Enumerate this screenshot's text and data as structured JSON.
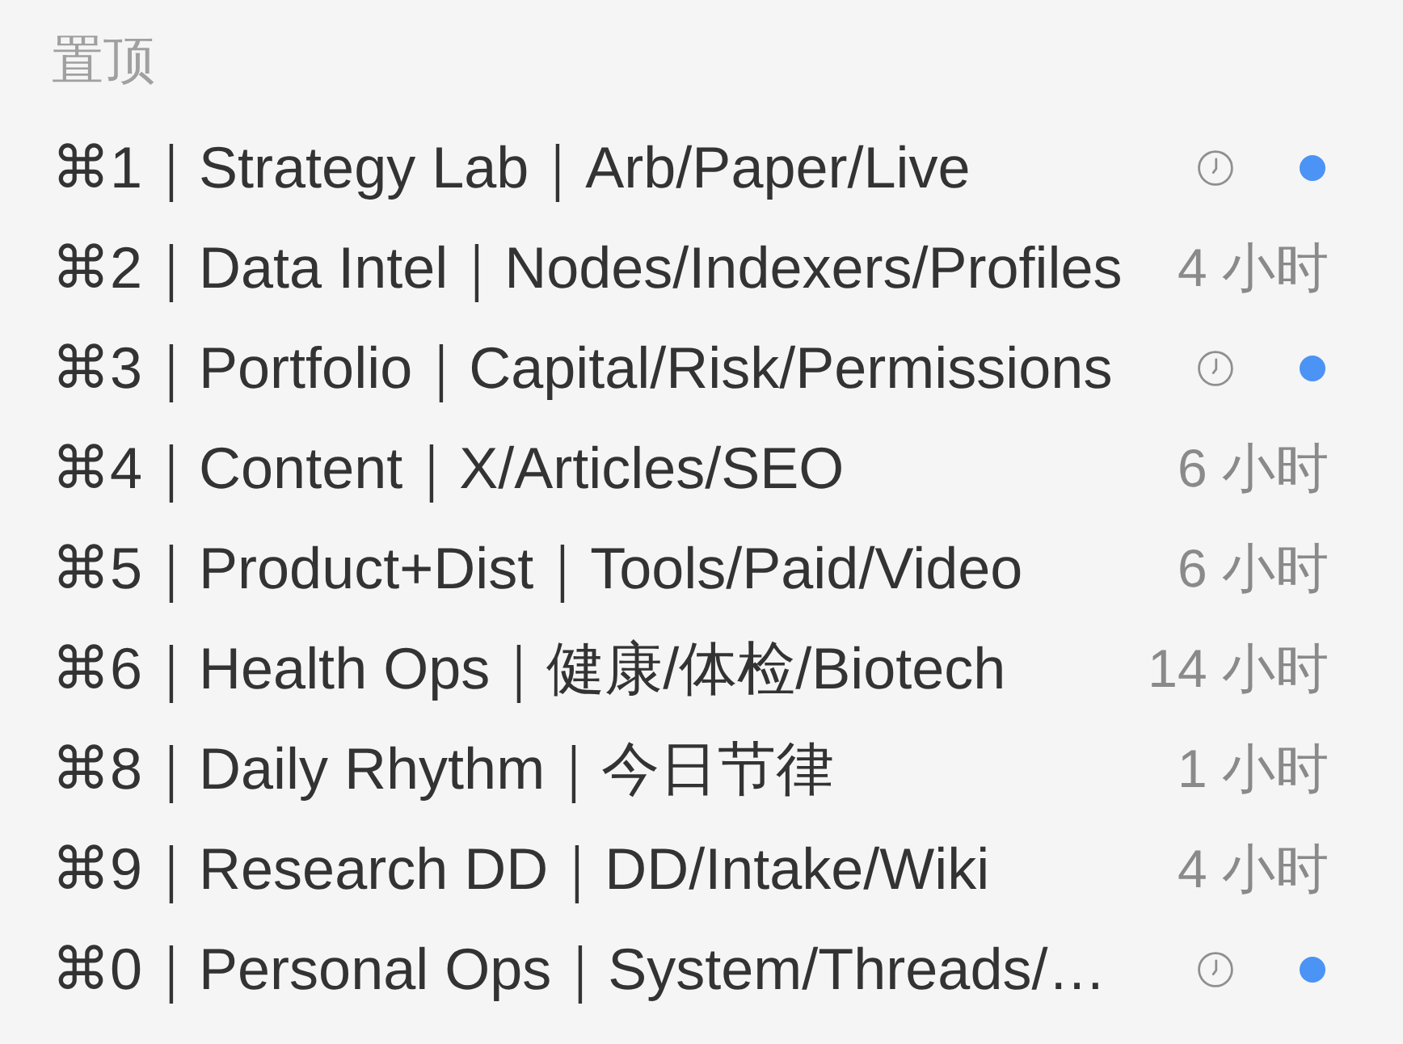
{
  "section": {
    "title": "置顶"
  },
  "items": [
    {
      "label": "⌘1｜Strategy Lab｜Arb/Paper/Live",
      "kind": "scheduled",
      "unread": true
    },
    {
      "label": "⌘2｜Data Intel｜Nodes/Indexers/Profiles",
      "kind": "time",
      "time": "4 小时",
      "unread": false
    },
    {
      "label": "⌘3｜Portfolio｜Capital/Risk/Permissions",
      "kind": "scheduled",
      "unread": true
    },
    {
      "label": "⌘4｜Content｜X/Articles/SEO",
      "kind": "time",
      "time": "6 小时",
      "unread": false
    },
    {
      "label": "⌘5｜Product+Dist｜Tools/Paid/Video",
      "kind": "time",
      "time": "6 小时",
      "unread": false
    },
    {
      "label": "⌘6｜Health Ops｜健康/体检/Biotech",
      "kind": "time",
      "time": "14 小时",
      "unread": false
    },
    {
      "label": "⌘8｜Daily Rhythm｜今日节律",
      "kind": "time",
      "time": "1 小时",
      "unread": false
    },
    {
      "label": "⌘9｜Research DD｜DD/Intake/Wiki",
      "kind": "time",
      "time": "4 小时",
      "unread": false
    },
    {
      "label": "⌘0｜Personal Ops｜System/Threads/…",
      "kind": "scheduled",
      "unread": true
    }
  ]
}
